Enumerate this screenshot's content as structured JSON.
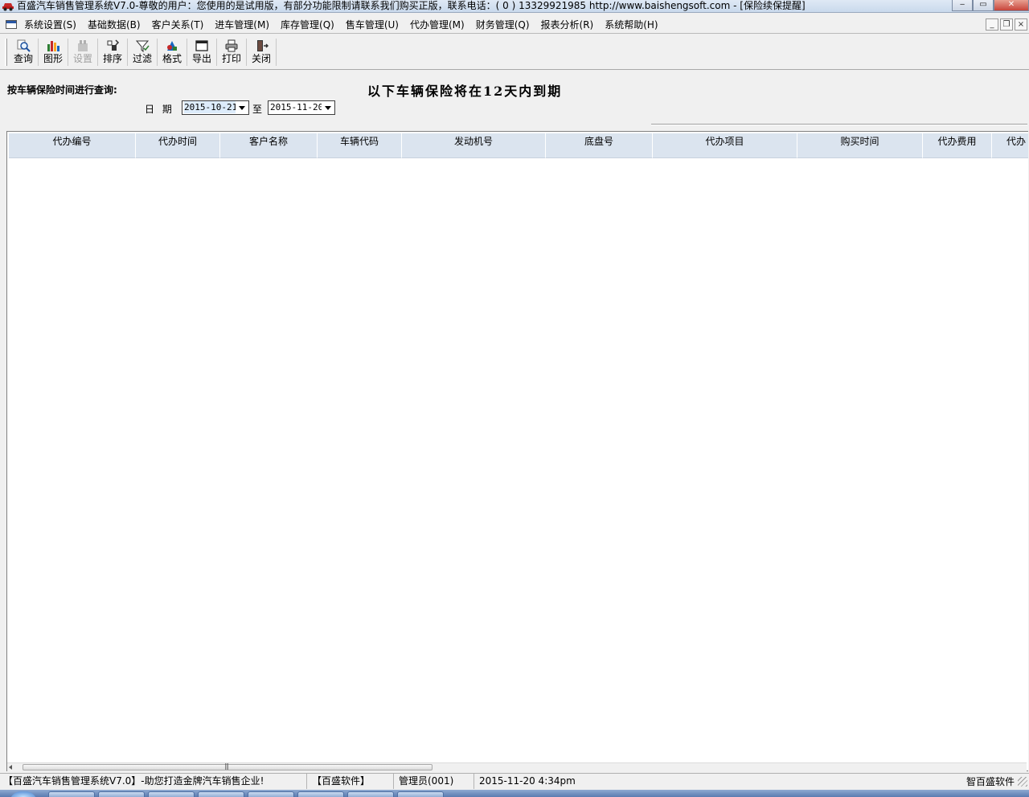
{
  "window": {
    "title": "百盛汽车销售管理系统V7.0-尊敬的用户：您使用的是试用版，有部分功能限制请联系我们购买正版，联系电话：( 0 ) 13329921985  http://www.baishengsoft.com - [保险续保提醒]",
    "app_icon": "car-icon",
    "minimize": "‒",
    "restore": "▭",
    "close": "✕"
  },
  "menubar": {
    "items": [
      {
        "label": "系统设置(S)"
      },
      {
        "label": "基础数据(B)"
      },
      {
        "label": "客户关系(T)"
      },
      {
        "label": "进车管理(M)"
      },
      {
        "label": "库存管理(Q)"
      },
      {
        "label": "售车管理(U)"
      },
      {
        "label": "代办管理(M)"
      },
      {
        "label": "财务管理(Q)"
      },
      {
        "label": "报表分析(R)"
      },
      {
        "label": "系统帮助(H)"
      }
    ],
    "mdi_minimize": "_",
    "mdi_restore": "❐",
    "mdi_close": "×"
  },
  "toolbar": {
    "items": [
      {
        "label": "查询",
        "icon": "magnifier-icon",
        "enabled": true
      },
      {
        "label": "图形",
        "icon": "bar-chart-icon",
        "enabled": true
      },
      {
        "label": "设置",
        "icon": "settings-icon",
        "enabled": false
      },
      {
        "label": "排序",
        "icon": "sort-icon",
        "enabled": true
      },
      {
        "label": "过滤",
        "icon": "filter-icon",
        "enabled": true
      },
      {
        "label": "格式",
        "icon": "format-icon",
        "enabled": true
      },
      {
        "label": "导出",
        "icon": "export-icon",
        "enabled": true
      },
      {
        "label": "打印",
        "icon": "printer-icon",
        "enabled": true
      },
      {
        "label": "关闭",
        "icon": "exit-door-icon",
        "enabled": true
      }
    ]
  },
  "query": {
    "title": "按车辆保险时间进行查询:",
    "notice": "以下车辆保险将在12天内到期",
    "date_label": "日 期",
    "start_date": "2015-10-21",
    "to_label": "至",
    "end_date": "2015-11-20"
  },
  "grid": {
    "columns": [
      {
        "label": "代办编号"
      },
      {
        "label": "代办时间"
      },
      {
        "label": "客户名称"
      },
      {
        "label": "车辆代码"
      },
      {
        "label": "发动机号"
      },
      {
        "label": "底盘号"
      },
      {
        "label": "代办项目"
      },
      {
        "label": "购买时间"
      },
      {
        "label": "代办费用"
      },
      {
        "label": "代办"
      }
    ],
    "rows": []
  },
  "statusbar": {
    "app_slogan": "【百盛汽车销售管理系统V7.0】-助您打造金牌汽车销售企业!",
    "company": "【百盛软件】",
    "user": "管理员(001)",
    "datetime": "2015-11-20 4:34pm",
    "brand": "智百盛软件"
  },
  "colors": {
    "grid_header_bg": "#dbe4ef",
    "window_bg": "#f0f0f0",
    "date_highlight": "#ddecfb"
  }
}
